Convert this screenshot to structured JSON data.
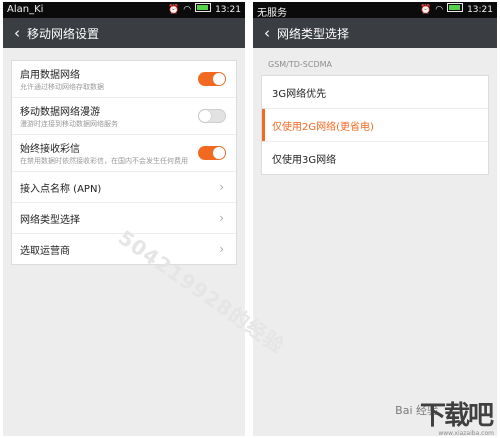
{
  "left": {
    "status": {
      "carrier": "Alan_Ki",
      "time": "13:21"
    },
    "title": "移动网络设置",
    "toggles": [
      {
        "label": "启用数据网络",
        "sub": "允许通过移动网络存取数据",
        "state": "on"
      },
      {
        "label": "移动数据网络漫游",
        "sub": "漫游时连接到移动数据网络服务",
        "state": "off"
      },
      {
        "label": "始终接收彩信",
        "sub": "在禁用数据时依然接收彩信，在国内不会发生任何费用",
        "state": "on"
      }
    ],
    "nav": [
      {
        "label": "接入点名称 (APN)"
      },
      {
        "label": "网络类型选择"
      },
      {
        "label": "选取运营商"
      }
    ]
  },
  "right": {
    "status": {
      "carrier": "无服务",
      "time": "13:21"
    },
    "title": "网络类型选择",
    "section": "GSM/TD-SCDMA",
    "options": [
      {
        "label": "3G网络优先",
        "selected": false
      },
      {
        "label": "仅使用2G网络(更省电)",
        "selected": true
      },
      {
        "label": "仅使用3G网络",
        "selected": false
      }
    ]
  },
  "overlay": {
    "watermark": "504219928的经验",
    "logo": "下载吧",
    "baidu": "Bai 经验",
    "url": "www.xiazaiba.com"
  },
  "colors": {
    "accent": "#f26a21",
    "titlebar": "#3a3d42",
    "statusbar": "#0b0b0b"
  }
}
